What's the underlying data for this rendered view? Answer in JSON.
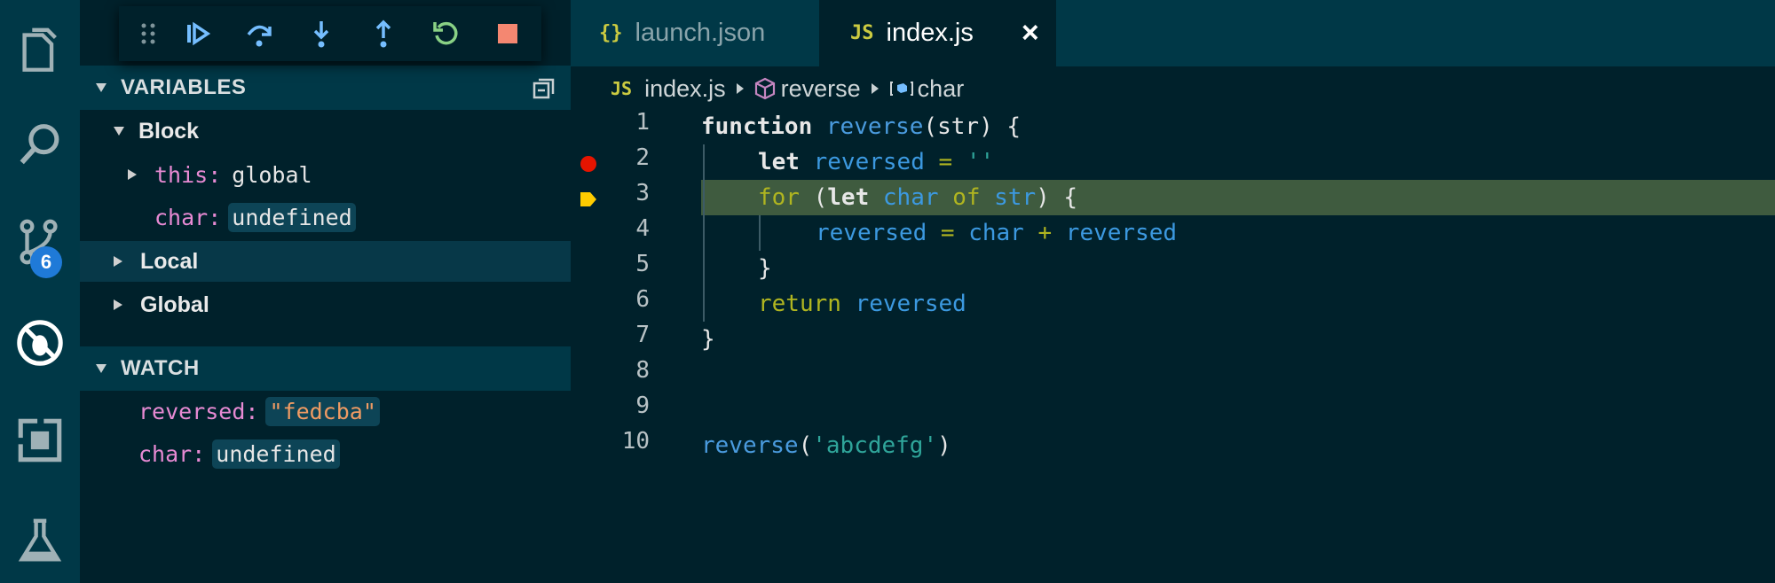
{
  "activity_bar": {
    "items": [
      {
        "name": "explorer"
      },
      {
        "name": "search"
      },
      {
        "name": "source-control",
        "badge": "6"
      },
      {
        "name": "debug"
      },
      {
        "name": "extensions"
      },
      {
        "name": "testing"
      }
    ]
  },
  "debug_toolbar": {
    "actions": [
      "drag-handle",
      "continue",
      "step-over",
      "step-into",
      "step-out",
      "restart",
      "stop"
    ]
  },
  "variables": {
    "header": "VARIABLES",
    "scopes": [
      {
        "label": "Block",
        "children": [
          {
            "name": "this:",
            "value": "global",
            "expandable": true
          },
          {
            "name": "char:",
            "value": "undefined",
            "expandable": false
          }
        ]
      },
      {
        "label": "Local"
      },
      {
        "label": "Global"
      }
    ]
  },
  "watch": {
    "header": "WATCH",
    "items": [
      {
        "name": "reversed:",
        "value": "\"fedcba\""
      },
      {
        "name": "char:",
        "value": "undefined"
      }
    ]
  },
  "editor": {
    "tabs": [
      {
        "icon": "{}",
        "label": "launch.json",
        "active": false
      },
      {
        "icon": "JS",
        "label": "index.js",
        "active": true,
        "close": "×"
      }
    ],
    "breadcrumb": {
      "file_icon": "JS",
      "file": "index.js",
      "symbol": "reverse",
      "variable": "char"
    },
    "line_numbers": [
      "1",
      "2",
      "3",
      "4",
      "5",
      "6",
      "7",
      "8",
      "9",
      "10"
    ],
    "code": {
      "l1": {
        "kw": "function",
        "fn": "reverse",
        "rest": "(str) {"
      },
      "l2": {
        "kw": "let",
        "id": "reversed",
        "op": "=",
        "str": "''"
      },
      "l3": {
        "kw2": "for",
        "p1": "(",
        "kw": "let",
        "id": "char",
        "of": "of",
        "id2": "str",
        "p2": ") {"
      },
      "l4": {
        "id": "reversed",
        "op": "=",
        "id2": "char",
        "plus": "+",
        "id3": "reversed"
      },
      "l5": {
        "text": "}"
      },
      "l6": {
        "kw2": "return",
        "id": "reversed"
      },
      "l7": {
        "text": "}"
      },
      "l10": {
        "fn": "reverse",
        "p1": "(",
        "str": "'abcdefg'",
        "p2": ")"
      }
    },
    "breakpoint_line": "2",
    "current_line": "3"
  }
}
